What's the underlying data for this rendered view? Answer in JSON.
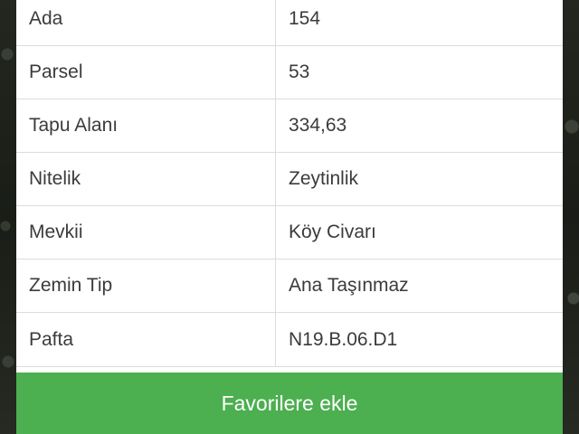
{
  "property_details": [
    {
      "label": "Ada",
      "value": "154"
    },
    {
      "label": "Parsel",
      "value": "53"
    },
    {
      "label": "Tapu Alanı",
      "value": "334,63"
    },
    {
      "label": "Nitelik",
      "value": "Zeytinlik"
    },
    {
      "label": "Mevkii",
      "value": "Köy Civarı"
    },
    {
      "label": "Zemin Tip",
      "value": "Ana Taşınmaz"
    },
    {
      "label": "Pafta",
      "value": "N19.B.06.D1"
    }
  ],
  "actions": {
    "favorite_label": "Favorilere ekle"
  },
  "colors": {
    "button": "#4caf50",
    "text": "#3b3b3b",
    "divider": "#dcdcdc"
  }
}
